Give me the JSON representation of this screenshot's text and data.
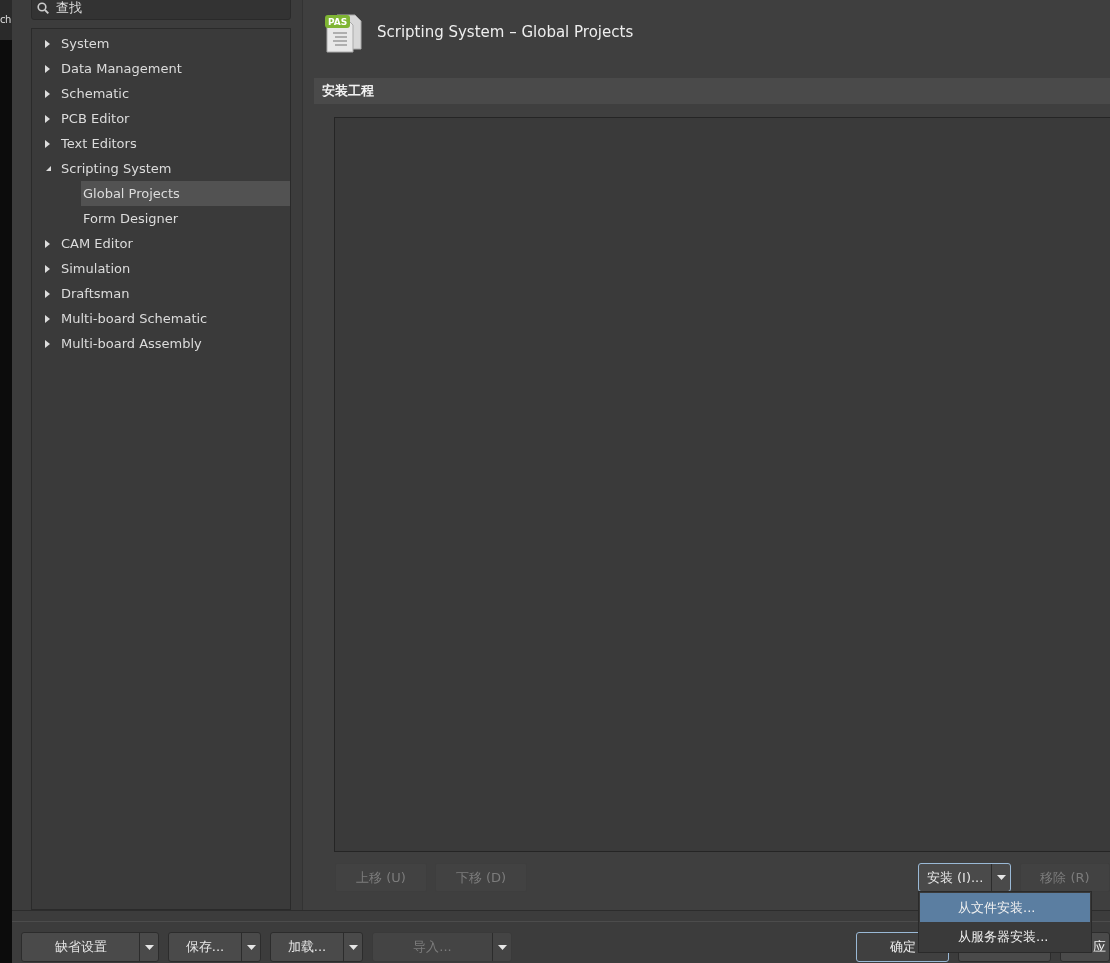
{
  "background_window": {
    "text": "ch"
  },
  "search": {
    "placeholder": "查找"
  },
  "tree": [
    {
      "label": "System",
      "expanded": false,
      "selected": false
    },
    {
      "label": "Data Management",
      "expanded": false,
      "selected": false
    },
    {
      "label": "Schematic",
      "expanded": false,
      "selected": false
    },
    {
      "label": "PCB Editor",
      "expanded": false,
      "selected": false
    },
    {
      "label": "Text Editors",
      "expanded": false,
      "selected": false
    },
    {
      "label": "Scripting System",
      "expanded": true,
      "selected": false,
      "children": [
        {
          "label": "Global Projects",
          "selected": true
        },
        {
          "label": "Form Designer",
          "selected": false
        }
      ]
    },
    {
      "label": "CAM Editor",
      "expanded": false,
      "selected": false
    },
    {
      "label": "Simulation",
      "expanded": false,
      "selected": false
    },
    {
      "label": "Draftsman",
      "expanded": false,
      "selected": false
    },
    {
      "label": "Multi-board Schematic",
      "expanded": false,
      "selected": false
    },
    {
      "label": "Multi-board Assembly",
      "expanded": false,
      "selected": false
    }
  ],
  "page": {
    "icon_text": "PAS",
    "title": "Scripting System – Global Projects"
  },
  "section": {
    "title": "安装工程"
  },
  "list_buttons": [
    {
      "label": "上移 (U)",
      "kind": "plain",
      "disabled": true,
      "focused": false
    },
    {
      "label": "下移 (D)",
      "kind": "plain",
      "disabled": true,
      "focused": false
    }
  ],
  "install_button": {
    "label": "安装 (I)...",
    "disabled": false,
    "focused": true
  },
  "remove_button": {
    "label": "移除 (R)",
    "disabled": true
  },
  "install_menu": [
    {
      "label": "从文件安装...",
      "selected": true
    },
    {
      "label": "从服务器安装...",
      "selected": false
    }
  ],
  "bottom_buttons": [
    {
      "label": "缺省设置",
      "kind": "split",
      "disabled": false,
      "focused": false
    },
    {
      "label": "保存...",
      "kind": "split",
      "disabled": false,
      "focused": false
    },
    {
      "label": "加载...",
      "kind": "split",
      "disabled": false,
      "focused": false
    },
    {
      "label": "导入...",
      "kind": "split",
      "disabled": true,
      "focused": false
    }
  ],
  "dialog_buttons": [
    {
      "label": "确定",
      "kind": "plain",
      "focused": true
    },
    {
      "kind": "blank",
      "focused": false
    },
    {
      "label": "应",
      "kind": "plain",
      "focused": false
    }
  ]
}
